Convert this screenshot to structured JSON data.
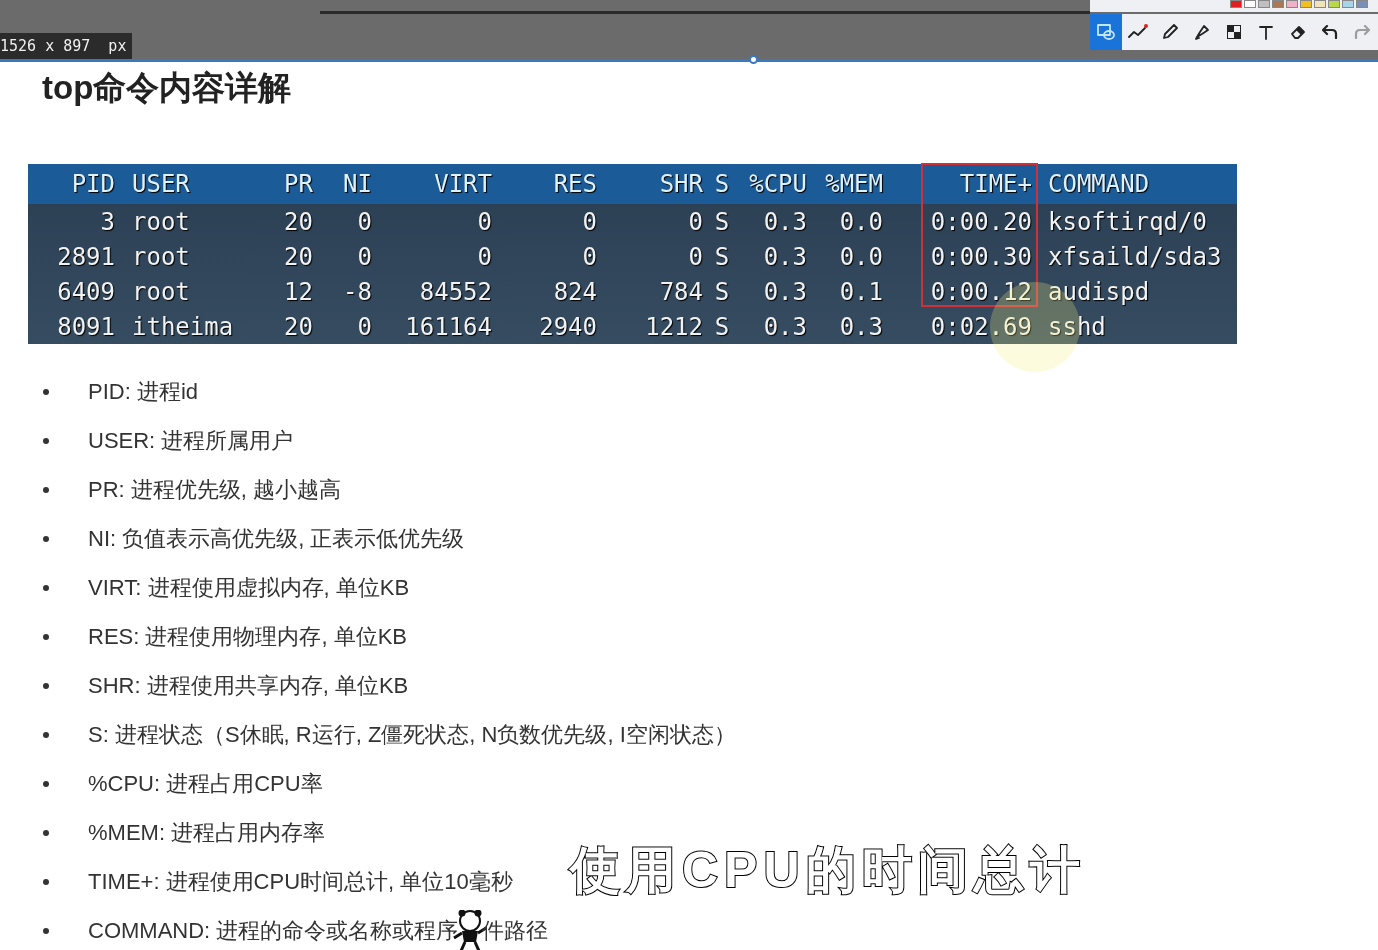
{
  "capture": {
    "size_label": "1526 x 897  px"
  },
  "toolbar": {
    "palette": [
      {
        "color": "#e02020"
      },
      {
        "color": "#ffffff"
      },
      {
        "color": "#c0c0c0"
      },
      {
        "color": "#a87858"
      },
      {
        "color": "#f0b0c8"
      },
      {
        "color": "#f0c020"
      },
      {
        "color": "#f0e4b8"
      },
      {
        "color": "#b8d848"
      },
      {
        "color": "#a8d4e8"
      },
      {
        "color": "#7890b8"
      }
    ],
    "tools": [
      {
        "kind": "shape",
        "selected": true,
        "disabled": false
      },
      {
        "kind": "polyline",
        "selected": false,
        "disabled": false
      },
      {
        "kind": "pen",
        "selected": false,
        "disabled": false
      },
      {
        "kind": "marker",
        "selected": false,
        "disabled": false
      },
      {
        "kind": "mosaic",
        "selected": false,
        "disabled": false
      },
      {
        "kind": "text",
        "selected": false,
        "disabled": false
      },
      {
        "kind": "eraser",
        "selected": false,
        "disabled": false
      },
      {
        "kind": "undo",
        "selected": false,
        "disabled": false
      },
      {
        "kind": "redo",
        "selected": false,
        "disabled": true
      }
    ]
  },
  "slide": {
    "title": "top命令内容详解",
    "table": {
      "columns": [
        "PID",
        "USER",
        "PR",
        "NI",
        "VIRT",
        "RES",
        "SHR",
        "S",
        "%CPU",
        "%MEM",
        "TIME+",
        "COMMAND"
      ],
      "rows": [
        {
          "cells": [
            "3",
            "root",
            "20",
            "0",
            "0",
            "0",
            "0",
            "S",
            "0.3",
            "0.0",
            "0:00.20",
            "ksoftirqd/0"
          ]
        },
        {
          "cells": [
            "2891",
            "root",
            "20",
            "0",
            "0",
            "0",
            "0",
            "S",
            "0.3",
            "0.0",
            "0:00.30",
            "xfsaild/sda3"
          ]
        },
        {
          "cells": [
            "6409",
            "root",
            "12",
            "-8",
            "84552",
            "824",
            "784",
            "S",
            "0.3",
            "0.1",
            "0:00.12",
            "audispd"
          ]
        },
        {
          "cells": [
            "8091",
            "itheima",
            "20",
            "0",
            "161164",
            "2940",
            "1212",
            "S",
            "0.3",
            "0.3",
            "0:02.69",
            "sshd"
          ]
        }
      ]
    },
    "points": [
      {
        "text": "PID: 进程id"
      },
      {
        "text": "USER: 进程所属用户"
      },
      {
        "text": "PR: 进程优先级, 越小越高"
      },
      {
        "text": "NI: 负值表示高优先级, 正表示低优先级"
      },
      {
        "text": "VIRT: 进程使用虚拟内存, 单位KB"
      },
      {
        "text": "RES: 进程使用物理内存, 单位KB"
      },
      {
        "text": "SHR: 进程使用共享内存, 单位KB"
      },
      {
        "text": "S: 进程状态（S休眠, R运行, Z僵死状态, N负数优先级, I空闲状态）"
      },
      {
        "text": "%CPU: 进程占用CPU率"
      },
      {
        "text": "%MEM: 进程占用内存率"
      },
      {
        "text": "TIME+: 进程使用CPU时间总计, 单位10毫秒"
      },
      {
        "text": "COMMAND: 进程的命令或名称或程序",
        "text_after_sticker": "件路径"
      }
    ]
  },
  "subtitle": "使用CPU的时间总计"
}
